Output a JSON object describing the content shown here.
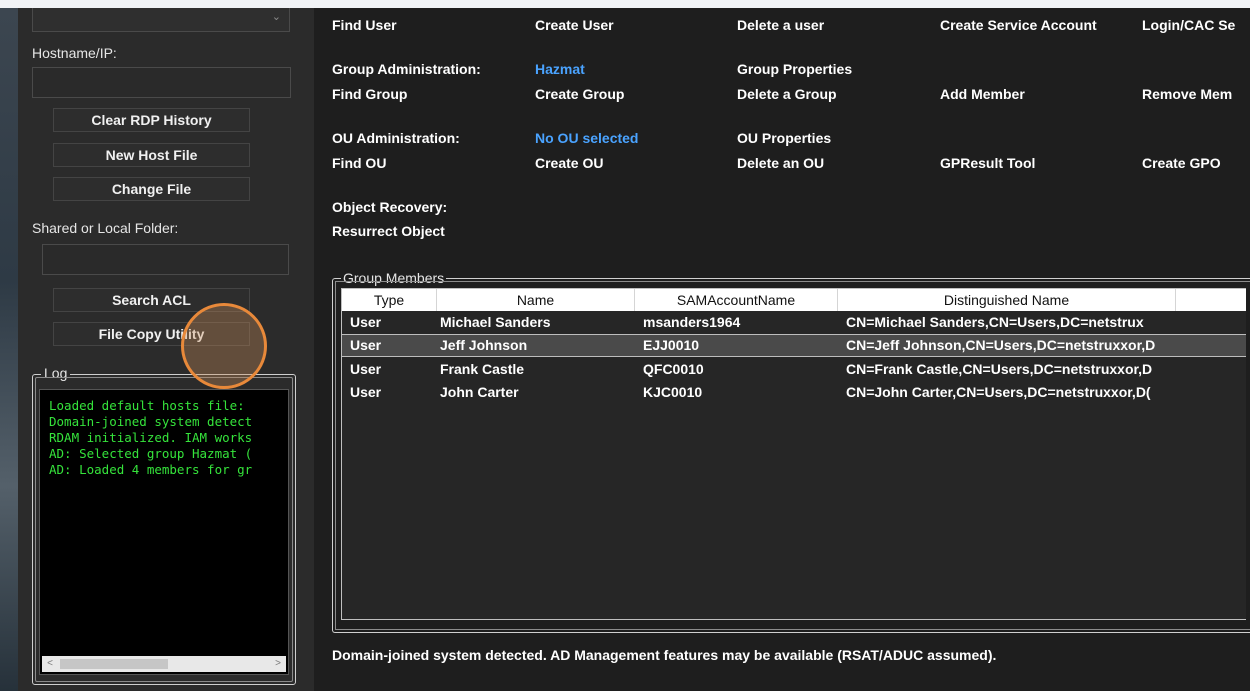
{
  "left_panel": {
    "host_combo_value": "",
    "hostname_label": "Hostname/IP:",
    "hostname_value": "",
    "buttons": {
      "clear_rdp": "Clear RDP History",
      "new_host_file": "New Host File",
      "change_file": "Change File",
      "search_acl": "Search ACL",
      "file_copy": "File Copy Utility"
    },
    "shared_folder_label": "Shared or Local Folder:",
    "shared_folder_value": "",
    "log_title": "Log",
    "log_lines": [
      "Loaded default hosts file:",
      "Domain-joined system detect",
      "RDAM initialized. IAM works",
      "AD: Selected group Hazmat (",
      "AD: Loaded 4 members for gr"
    ]
  },
  "commands": {
    "user_row": [
      "Find User",
      "Create User",
      "Delete a user",
      "Create Service Account",
      "Login/CAC Se"
    ],
    "group_admin_label": "Group Administration:",
    "group_selected": "Hazmat",
    "group_properties": "Group Properties",
    "group_row": [
      "Find Group",
      "Create Group",
      "Delete a Group",
      "Add Member",
      "Remove Mem"
    ],
    "ou_admin_label": "OU Administration:",
    "ou_selected": "No OU selected",
    "ou_properties": "OU Properties",
    "ou_row": [
      "Find OU",
      "Create OU",
      "Delete an OU",
      "GPResult Tool",
      "Create GPO"
    ],
    "object_recovery_label": "Object Recovery:",
    "resurrect_object": "Resurrect Object"
  },
  "group_members": {
    "title": "Group Members",
    "columns": [
      "Type",
      "Name",
      "SAMAccountName",
      "Distinguished Name"
    ],
    "rows": [
      {
        "type": "User",
        "name": "Michael Sanders",
        "sam": "msanders1964",
        "dn": "CN=Michael Sanders,CN=Users,DC=netstrux"
      },
      {
        "type": "User",
        "name": "Jeff Johnson",
        "sam": "EJJ0010",
        "dn": "CN=Jeff Johnson,CN=Users,DC=netstruxxor,D"
      },
      {
        "type": "User",
        "name": "Frank Castle",
        "sam": "QFC0010",
        "dn": "CN=Frank Castle,CN=Users,DC=netstruxxor,D"
      },
      {
        "type": "User",
        "name": "John Carter",
        "sam": "KJC0010",
        "dn": "CN=John Carter,CN=Users,DC=netstruxxor,D("
      }
    ],
    "selected_row": 1
  },
  "status_text": "Domain-joined system detected. AD Management features may be available (RSAT/ADUC assumed).",
  "colors": {
    "accent": "#4aa3ff",
    "log_text": "#35e33b",
    "cursor": "#e8893a"
  }
}
